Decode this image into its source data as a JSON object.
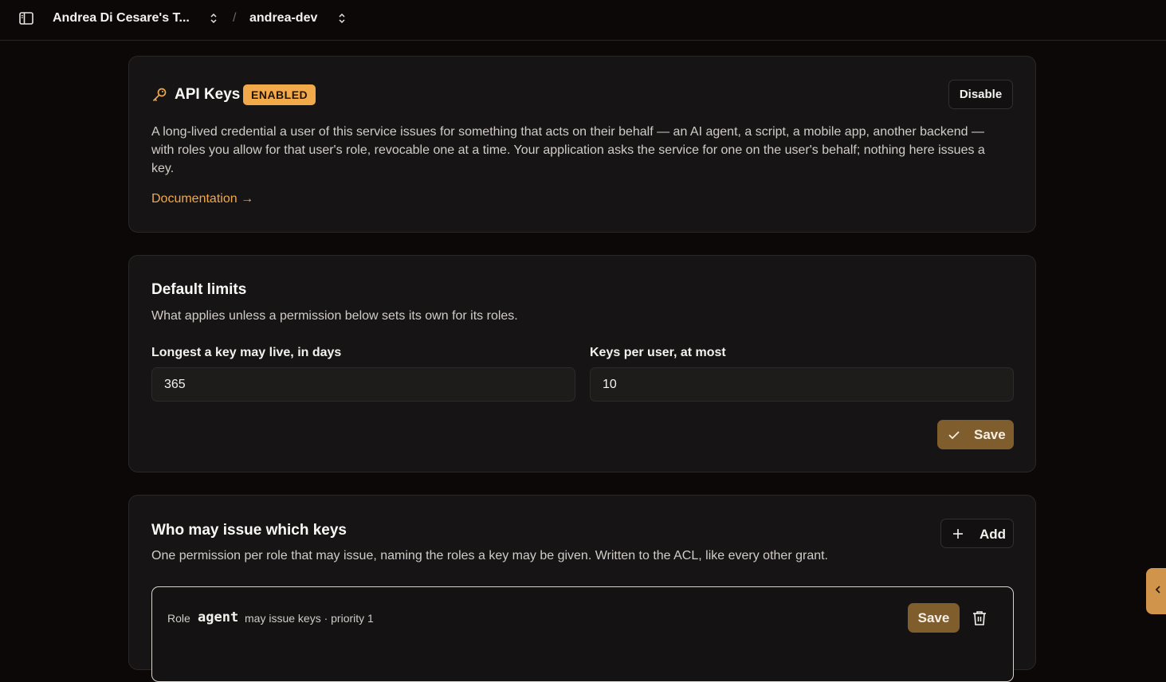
{
  "header": {
    "team": "Andrea Di Cesare's T...",
    "separator": "/",
    "project": "andrea-dev"
  },
  "api_keys": {
    "title": "API Keys",
    "badge": "ENABLED",
    "disable_label": "Disable",
    "description": "A long-lived credential a user of this service issues for something that acts on their behalf — an AI agent, a script, a mobile app, another backend — with roles you allow for that user's role, revocable one at a time. Your application asks the service for one on the user's behalf; nothing here issues a key.",
    "doc_link": "Documentation →"
  },
  "default_limits": {
    "title": "Default limits",
    "description": "What applies unless a permission below sets its own for its roles.",
    "days_label": "Longest a key may live, in days",
    "days_value": "365",
    "keys_label": "Keys per user, at most",
    "keys_value": "10",
    "save_label": "Save"
  },
  "issuers": {
    "title": "Who may issue which keys",
    "description": "One permission per role that may issue, naming the roles a key may be given. Written to the ACL, like every other grant.",
    "add_label": "Add",
    "permission": {
      "role_label": "Role",
      "role_name": "agent",
      "meta": "may issue keys · priority 1",
      "save_label": "Save"
    }
  },
  "colors": {
    "accent": "#f2a94a",
    "save_bg": "#7f5d2c",
    "card_bg": "#161414",
    "page_bg": "#0c0807"
  },
  "icons": [
    "sidebar-toggle-icon",
    "chevron-up-down-icon",
    "key-icon",
    "check-icon",
    "plus-icon",
    "trash-icon",
    "chevron-left-icon"
  ]
}
